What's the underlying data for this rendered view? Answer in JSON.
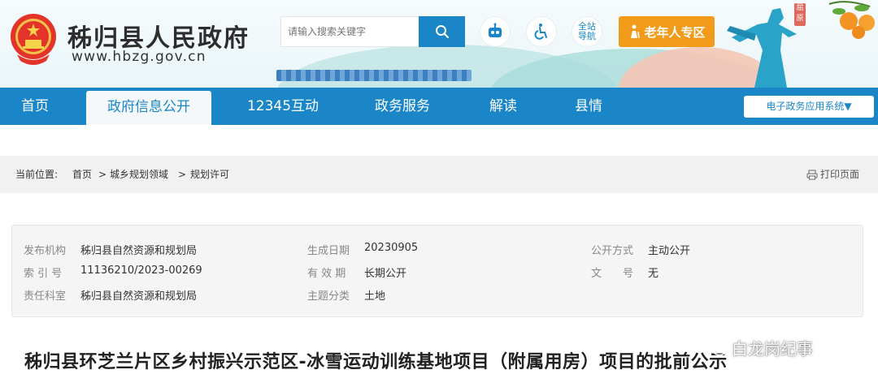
{
  "header": {
    "site_title": "秭归县人民政府",
    "site_url": "www.hbzg.gov.cn",
    "search_placeholder": "请输入搜索关键字",
    "site_nav_label_line1": "全站",
    "site_nav_label_line2": "导航",
    "elder_zone_label": "老年人专区",
    "stamp_text": "屈原"
  },
  "nav": {
    "items": [
      {
        "label": "首页"
      },
      {
        "label": "政府信息公开"
      },
      {
        "label": "12345互动"
      },
      {
        "label": "政务服务"
      },
      {
        "label": "解读"
      },
      {
        "label": "县情"
      }
    ],
    "active_index": 1,
    "eservice_label": "电子政务应用系统▼"
  },
  "breadcrumb": {
    "prefix": "当前位置:",
    "items": [
      "首页",
      "城乡规划领域",
      "规划许可"
    ],
    "separator": ">",
    "print_label": "打印页面"
  },
  "info": {
    "rows": [
      [
        {
          "label": "发布机构",
          "value": "秭归县自然资源和规划局"
        },
        {
          "label": "生成日期",
          "value": "20230905"
        },
        {
          "label": "公开方式",
          "value": "主动公开"
        }
      ],
      [
        {
          "label": "索 引 号",
          "value": "11136210/2023-00269"
        },
        {
          "label": "有 效 期",
          "value": "长期公开"
        },
        {
          "label": "文　　号",
          "value": "无"
        }
      ],
      [
        {
          "label": "责任科室",
          "value": "秭归县自然资源和规划局"
        },
        {
          "label": "主题分类",
          "value": "土地"
        }
      ]
    ]
  },
  "article": {
    "title": "秭归县环芝兰片区乡村振兴示范区-冰雪运动训练基地项目（附属用房）项目的批前公示"
  },
  "watermark": {
    "text": "白龙岗纪事"
  },
  "colors": {
    "primary": "#1a86c8",
    "elder_button": "#f29a1a",
    "breadcrumb_bg": "#f1f1f1",
    "info_bg": "#f5f5f5"
  }
}
